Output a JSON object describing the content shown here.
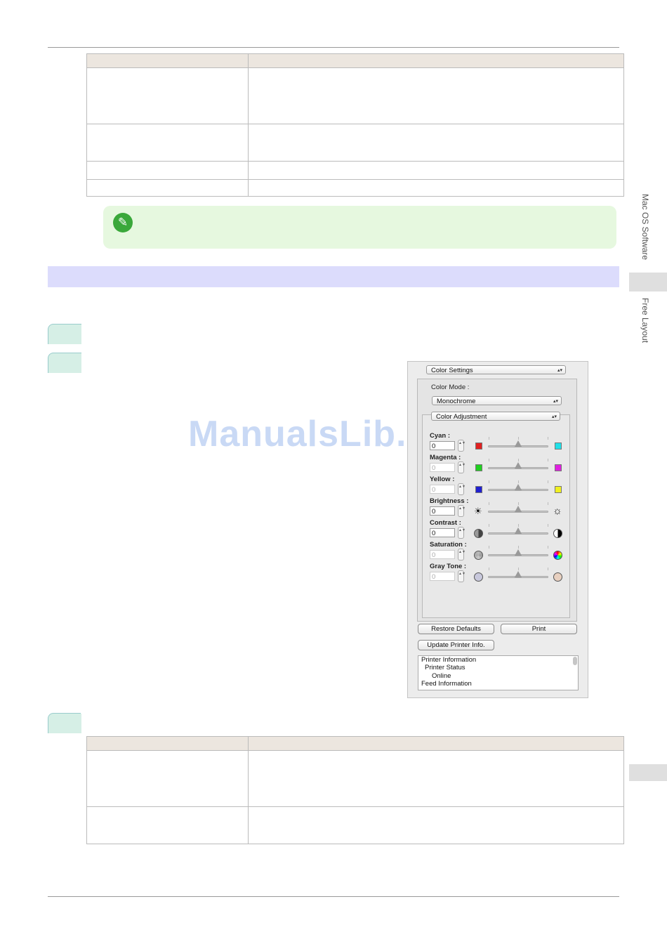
{
  "watermark": "ManualsLib.com",
  "side_nav": {
    "chapter": "Mac OS Software",
    "section": "Free Layout"
  },
  "panel": {
    "settings_menu": "Color Settings",
    "color_mode_label": "Color Mode :",
    "color_mode_value": "Monochrome",
    "adjust_menu": "Color Adjustment",
    "sliders": [
      {
        "label": "Cyan :",
        "value": "0",
        "enabled": true,
        "left_color": "#e02020",
        "right_color": "#20e0e8",
        "icon": "swatch"
      },
      {
        "label": "Magenta :",
        "value": "0",
        "enabled": false,
        "left_color": "#20d020",
        "right_color": "#e020e0",
        "icon": "swatch"
      },
      {
        "label": "Yellow :",
        "value": "0",
        "enabled": false,
        "left_color": "#2020d0",
        "right_color": "#f0f020",
        "icon": "swatch"
      },
      {
        "label": "Brightness :",
        "value": "0",
        "enabled": true,
        "icon": "sun"
      },
      {
        "label": "Contrast :",
        "value": "0",
        "enabled": true,
        "icon": "contrast"
      },
      {
        "label": "Saturation :",
        "value": "0",
        "enabled": false,
        "icon": "saturation"
      },
      {
        "label": "Gray Tone :",
        "value": "0",
        "enabled": false,
        "icon": "graytone"
      }
    ],
    "restore_button": "Restore Defaults",
    "print_button": "Print",
    "update_button": "Update Printer Info.",
    "info_lines": [
      "Printer Information",
      "Printer Status",
      "Online",
      "Feed Information"
    ]
  }
}
